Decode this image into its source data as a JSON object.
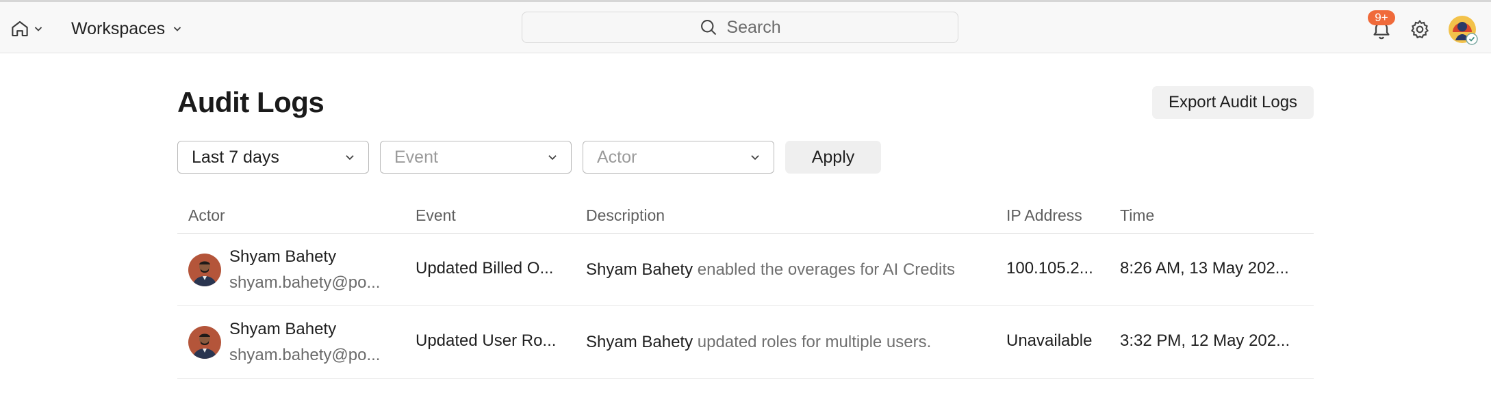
{
  "topbar": {
    "home_icon": "home-icon",
    "workspaces_label": "Workspaces",
    "search_placeholder": "Search",
    "notifications_badge": "9+",
    "icons": [
      "chevron-down-icon",
      "search-icon",
      "bell-icon",
      "gear-icon"
    ]
  },
  "page": {
    "title": "Audit Logs",
    "export_label": "Export Audit Logs"
  },
  "filters": {
    "date_range_value": "Last 7 days",
    "event_placeholder": "Event",
    "actor_placeholder": "Actor",
    "apply_label": "Apply"
  },
  "table": {
    "columns": [
      "Actor",
      "Event",
      "Description",
      "IP Address",
      "Time"
    ],
    "rows": [
      {
        "actor_name": "Shyam Bahety",
        "actor_email": "shyam.bahety@po...",
        "event": "Updated Billed O...",
        "desc_actor": "Shyam Bahety",
        "desc_action": "enabled the overages for AI Credits",
        "ip": "100.105.2...",
        "time": "8:26 AM, 13 May 202..."
      },
      {
        "actor_name": "Shyam Bahety",
        "actor_email": "shyam.bahety@po...",
        "event": "Updated User Ro...",
        "desc_actor": "Shyam Bahety",
        "desc_action": "updated roles for multiple users.",
        "ip": "Unavailable",
        "time": "3:32 PM, 12 May 202..."
      }
    ]
  },
  "colors": {
    "badge": "#f06a3a",
    "topbar_bg": "#f8f8f8",
    "button_bg": "#f1f1f1"
  }
}
